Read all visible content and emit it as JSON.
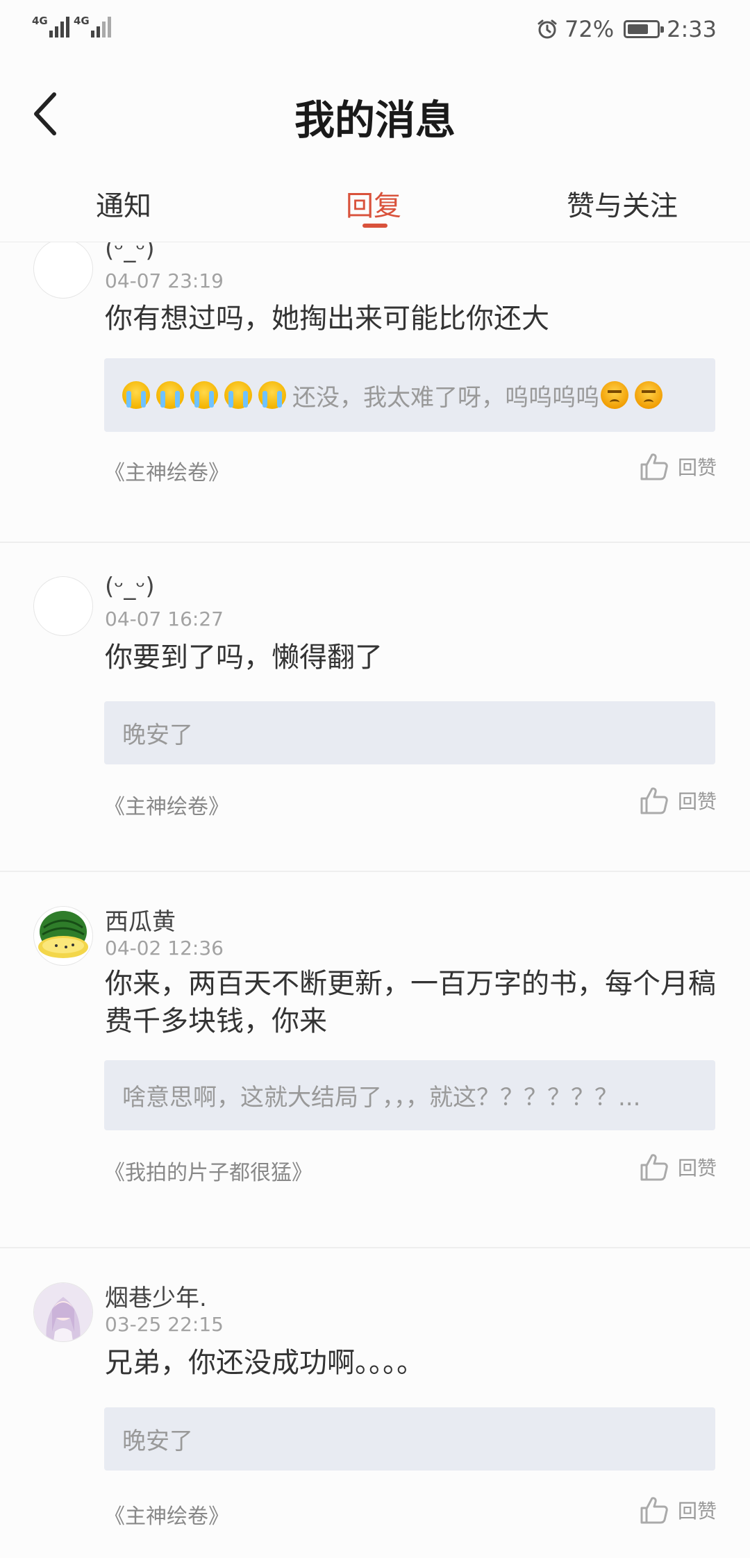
{
  "status_bar": {
    "network_1": "4G",
    "network_2": "4G",
    "battery_percent": "72%",
    "battery_level": 0.72,
    "time": "2:33",
    "icons": [
      "signal-icon",
      "alarm-icon",
      "battery-icon"
    ]
  },
  "header": {
    "title": "我的消息",
    "back_icon": "chevron-left-icon"
  },
  "tabs": [
    {
      "label": "通知",
      "active": false
    },
    {
      "label": "回复",
      "active": true
    },
    {
      "label": "赞与关注",
      "active": false
    }
  ],
  "colors": {
    "accent": "#d9523b",
    "quote_bg": "#e8ebf2"
  },
  "messages": [
    {
      "user": "(ᵕ_ᵕ)",
      "time": "04-07 23:19",
      "content": "你有想过吗，她掏出来可能比你还大",
      "quote_prefix_emoji": [
        "cry",
        "cry",
        "cry",
        "cry",
        "cry"
      ],
      "quote": "还没，我太难了呀，呜呜呜呜",
      "quote_suffix_emoji": [
        "angry",
        "angry"
      ],
      "book": "《主神绘卷》",
      "like_label": "回赞"
    },
    {
      "user": "(ᵕ_ᵕ)",
      "time": "04-07 16:27",
      "content": "你要到了吗，懒得翻了",
      "quote": "晚安了",
      "book": "《主神绘卷》",
      "like_label": "回赞"
    },
    {
      "user": "西瓜黄",
      "time": "04-02 12:36",
      "content": "你来，两百天不断更新，一百万字的书，每个月稿费千多块钱，你来",
      "quote": "啥意思啊，这就大结局了，，，就这？？？？？？...",
      "book": "《我拍的片子都很猛》",
      "like_label": "回赞"
    },
    {
      "user": "烟巷少年.",
      "time": "03-25 22:15",
      "content": "兄弟，你还没成功啊。。。。",
      "quote": "晚安了",
      "book": "《主神绘卷》",
      "like_label": "回赞"
    }
  ]
}
